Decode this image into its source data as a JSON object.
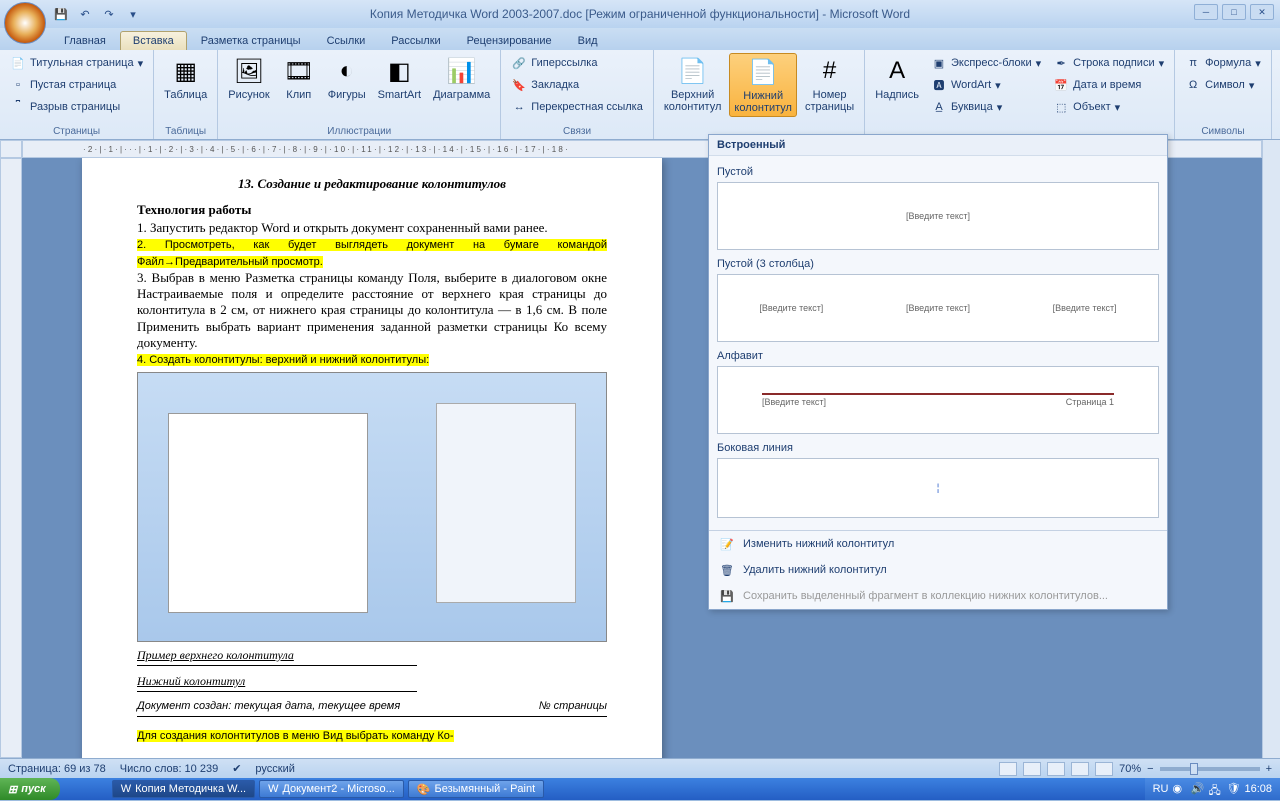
{
  "title": "Копия Методичка Word 2003-2007.doc [Режим ограниченной функциональности] - Microsoft Word",
  "tabs": [
    "Главная",
    "Вставка",
    "Разметка страницы",
    "Ссылки",
    "Рассылки",
    "Рецензирование",
    "Вид"
  ],
  "active_tab": 1,
  "ribbon": {
    "pages": {
      "label": "Страницы",
      "title_page": "Титульная страница",
      "blank": "Пустая страница",
      "break": "Разрыв страницы"
    },
    "tables": {
      "label": "Таблицы",
      "table": "Таблица"
    },
    "illus": {
      "label": "Иллюстрации",
      "picture": "Рисунок",
      "clip": "Клип",
      "shapes": "Фигуры",
      "smartart": "SmartArt",
      "chart": "Диаграмма"
    },
    "links": {
      "label": "Связи",
      "hyper": "Гиперссылка",
      "bookmark": "Закладка",
      "xref": "Перекрестная ссылка"
    },
    "headfoot": {
      "header": "Верхний\nколонтитул",
      "footer": "Нижний\nколонтитул",
      "pageno": "Номер\nстраницы"
    },
    "text": {
      "textbox": "Надпись",
      "quick": "Экспресс-блоки",
      "wordart": "WordArt",
      "dropcap": "Буквица",
      "sigline": "Строка подписи",
      "datetime": "Дата и время",
      "object": "Объект"
    },
    "symbols": {
      "label": "Символы",
      "formula": "Формула",
      "symbol": "Символ"
    }
  },
  "gallery": {
    "header": "Встроенный",
    "opts": [
      {
        "name": "Пустой",
        "ph": "[Введите текст]"
      },
      {
        "name": "Пустой (3 столбца)",
        "ph": "[Введите текст]"
      },
      {
        "name": "Алфавит",
        "ph": "[Введите текст]",
        "pg": "Страница 1"
      },
      {
        "name": "Боковая линия",
        "ph": ""
      }
    ],
    "cmd_edit": "Изменить нижний колонтитул",
    "cmd_del": "Удалить нижний колонтитул",
    "cmd_save": "Сохранить выделенный фрагмент в коллекцию нижних колонтитулов..."
  },
  "doc": {
    "h": "13. Создание и редактирование колонтитулов",
    "sub": "Технология работы",
    "p1": "1. Запустить редактор Word и открыть документ сохраненный вами ранее.",
    "p2": "2. Просмотреть, как будет выглядеть документ на бумаге командой Файл→Предварительный просмотр.",
    "p3": "3. Выбрав в меню Разметка страницы команду Поля, выберите в диалоговом окне Настраиваемые поля и определите расстояние от верхнего края страницы до колонтитула в 2 см, от нижнего края страницы до колонтитула — в 1,6 см. В поле Применить выбрать вариант применения заданной разметки страницы Ко всему документу.",
    "p4": "4. Создать колонтитулы: верхний и нижний колонтитулы:",
    "cap1": "Пример верхнего колонтитула",
    "cap2": "Нижний колонтитул",
    "cap3l": "Документ создан: текущая дата, текущее время",
    "cap3r": "№ страницы",
    "p5": "Для создания колонтитулов в меню Вид выбрать команду Ко-"
  },
  "status": {
    "page": "Страница: 69 из 78",
    "words": "Число слов: 10 239",
    "lang": "русский",
    "zoom": "70%"
  },
  "ruler": "·2·|·1·|···|·1·|·2·|·3·|·4·|·5·|·6·|·7·|·8·|·9·|·10·|·11·|·12·|·13·|·14·|·15·|·16·|·17·|·18·",
  "taskbar": {
    "start": "пуск",
    "items": [
      "Копия Методичка W...",
      "Документ2 - Microso...",
      "Безымянный - Paint"
    ],
    "lang": "RU",
    "time": "16:08"
  }
}
